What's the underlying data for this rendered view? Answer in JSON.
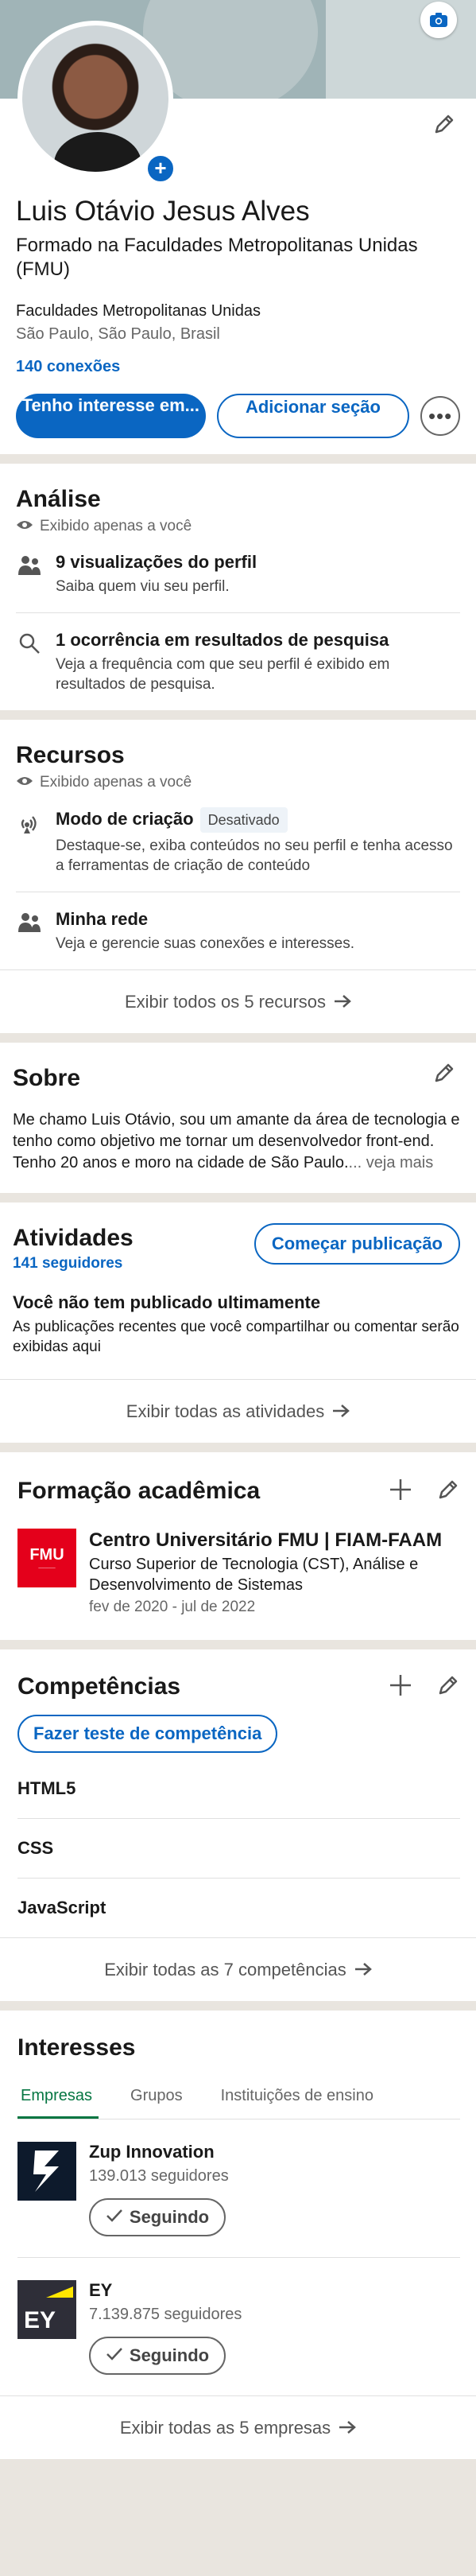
{
  "profile": {
    "name": "Luis Otávio Jesus Alves",
    "headline": "Formado na Faculdades Metropolitanas Unidas (FMU)",
    "company": "Faculdades Metropolitanas Unidas",
    "location": "São Paulo, São Paulo, Brasil",
    "connections": "140 conexões",
    "btn_open_to": "Tenho interesse em...",
    "btn_add_section": "Adicionar seção"
  },
  "analytics": {
    "title": "Análise",
    "private": "Exibido apenas a você",
    "items": [
      {
        "title": "9 visualizações do perfil",
        "sub": "Saiba quem viu seu perfil."
      },
      {
        "title": "1 ocorrência em resultados de pesquisa",
        "sub": "Veja a frequência com que seu perfil é exibido em resultados de pesquisa."
      }
    ]
  },
  "resources": {
    "title": "Recursos",
    "private": "Exibido apenas a você",
    "items": [
      {
        "title": "Modo de criação",
        "badge": "Desativado",
        "sub": "Destaque-se, exiba conteúdos no seu perfil e tenha acesso a ferramentas de criação de conteúdo"
      },
      {
        "title": "Minha rede",
        "sub": "Veja e gerencie suas conexões e interesses."
      }
    ],
    "show_all": "Exibir todos os 5 recursos"
  },
  "about": {
    "title": "Sobre",
    "text": "Me chamo Luis Otávio, sou um amante da área de tecnologia e tenho como objetivo me tornar um desenvolvedor front-end. Tenho 20 anos e moro na cidade de São Paulo.",
    "see_more": "... veja mais"
  },
  "activity": {
    "title": "Atividades",
    "followers": "141 seguidores",
    "start_post": "Começar publicação",
    "empty_title": "Você não tem publicado ultimamente",
    "empty_sub": "As publicações recentes que você compartilhar ou comentar serão exibidas aqui",
    "show_all": "Exibir todas as atividades"
  },
  "education": {
    "title": "Formação acadêmica",
    "logo_text": "FMU",
    "school": "Centro Universitário FMU | FIAM-FAAM",
    "degree": "Curso Superior de Tecnologia (CST), Análise e Desenvolvimento de Sistemas",
    "dates": "fev de 2020 - jul de 2022"
  },
  "skills": {
    "title": "Competências",
    "test_button": "Fazer teste de competência",
    "items": [
      "HTML5",
      "CSS",
      "JavaScript"
    ],
    "show_all": "Exibir todas as 7 competências"
  },
  "interests": {
    "title": "Interesses",
    "tabs": [
      "Empresas",
      "Grupos",
      "Instituições de ensino"
    ],
    "companies": [
      {
        "name": "Zup Innovation",
        "followers": "139.013 seguidores",
        "button": "Seguindo"
      },
      {
        "name": "EY",
        "followers": "7.139.875 seguidores",
        "button": "Seguindo"
      }
    ],
    "show_all": "Exibir todas as 5 empresas"
  },
  "colors": {
    "brand": "#0a66c2",
    "green": "#057642",
    "fmu_red": "#e4001b"
  },
  "icons": [
    "camera-icon",
    "plus-icon",
    "pencil-icon",
    "eye-icon",
    "people-icon",
    "search-icon",
    "broadcast-icon",
    "arrow-right-icon",
    "check-icon",
    "more-icon"
  ]
}
